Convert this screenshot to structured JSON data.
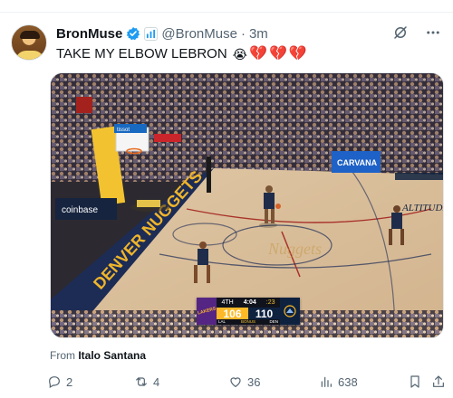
{
  "tweet": {
    "author_name": "BronMuse",
    "handle": "@BronMuse",
    "separator": "·",
    "time": "3m",
    "text": "TAKE MY ELBOW LEBRON",
    "emojis": [
      "😭",
      "💔",
      "💔",
      "💔"
    ]
  },
  "media": {
    "court_banner": "DENVER NUGGETS",
    "court_logo": "Nuggets",
    "sponsor_left": "coinbase",
    "sponsor_right": "CARVANA",
    "sponsor_top": "tissot",
    "courtside_ad": "ALTITUDE",
    "scoreboard": {
      "home_team": "LAL",
      "home_score": "106",
      "away_team": "DEN",
      "away_score": "110",
      "quarter": "4TH",
      "clock": "4:04",
      "shot_clock": ":23",
      "bonus": "BONUS",
      "lakers_label": "LAKERS"
    }
  },
  "attribution": {
    "prefix": "From",
    "source": "Italo Santana"
  },
  "actions": {
    "replies": "2",
    "reposts": "4",
    "likes": "36",
    "views": "638"
  },
  "colors": {
    "verified": "#1d9bf0",
    "lakers_purple": "#552583",
    "lakers_gold": "#fdb927",
    "nuggets_navy": "#0e2240",
    "court_wood": "#dcc2a0",
    "heart": "#d7263d"
  }
}
